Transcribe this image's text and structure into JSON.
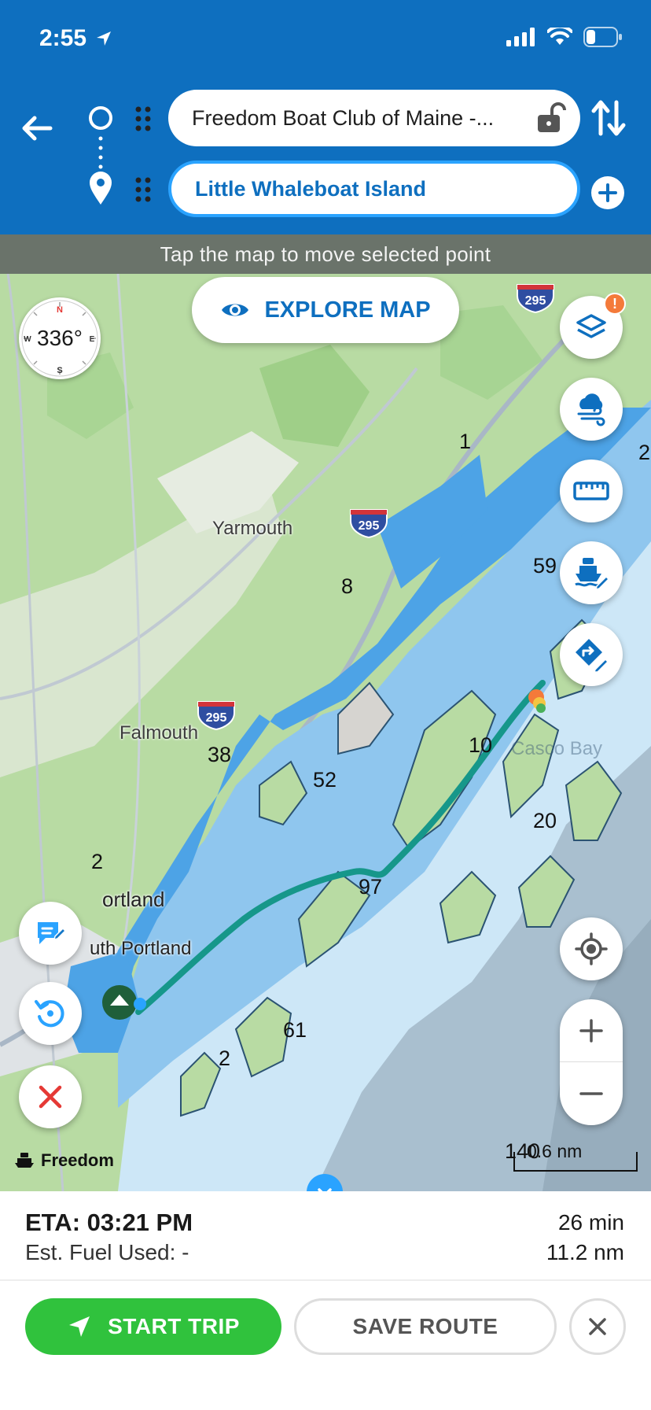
{
  "status_bar": {
    "time": "2:55"
  },
  "route": {
    "start_label": "Freedom Boat Club of Maine -...",
    "end_label": "Little Whaleboat Island"
  },
  "hint": "Tap the map to move selected point",
  "explore_label": "EXPLORE MAP",
  "compass": {
    "heading": "336°",
    "n": "N",
    "s": "S",
    "e": "E",
    "w": "W"
  },
  "layers_badge": "!",
  "map_labels": {
    "yarmouth": "Yarmouth",
    "falmouth": "Falmouth",
    "portland": "ortland",
    "south_portland": "uth Portland",
    "casco_bay": "Casco Bay"
  },
  "highway_shields": [
    "295",
    "295",
    "295"
  ],
  "depths": {
    "d1": "1",
    "d2_right": "2",
    "d59": "59",
    "d8": "8",
    "d38": "38",
    "d10": "10",
    "d52": "52",
    "d20": "20",
    "d2_port": "2",
    "d97": "97",
    "d2_south": "2",
    "d61": "61",
    "d140": "140"
  },
  "scale_label": "0.6 nm",
  "attribution": "Freedom",
  "trip": {
    "eta": "ETA: 03:21 PM",
    "fuel": "Est. Fuel Used: -",
    "duration": "26 min",
    "distance": "11.2 nm"
  },
  "actions": {
    "start_trip": "START TRIP",
    "save_route": "SAVE ROUTE"
  },
  "colors": {
    "header": "#0e6fbf",
    "accent": "#2aa3ff",
    "route_line": "#16978a",
    "start_button": "#30c23d",
    "close_red": "#e53935"
  }
}
